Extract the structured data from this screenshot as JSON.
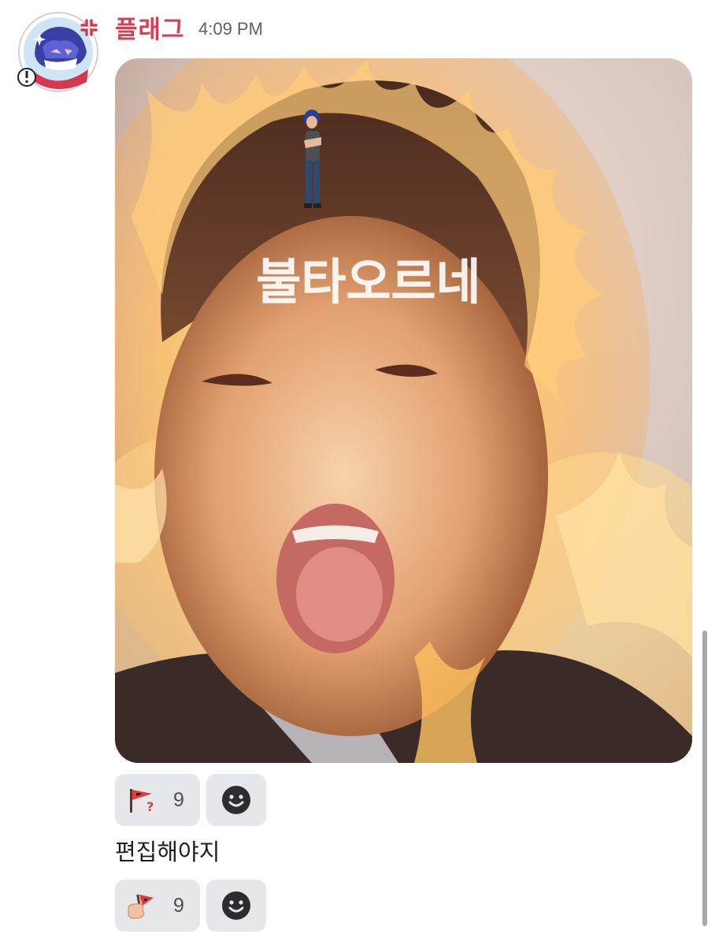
{
  "message": {
    "author": "플래그",
    "time": "4:09 PM",
    "attachment": {
      "overlay_text": "불타오르네"
    },
    "reactions": [
      {
        "emoji": "red-flag-question-icon",
        "count": "9"
      }
    ],
    "text": "편집해야지",
    "text_reactions": [
      {
        "emoji": "hand-holding-flag-icon",
        "count": "9"
      }
    ]
  },
  "colors": {
    "author": "#d73f55",
    "reaction_bg": "#e6e7ea",
    "timestamp": "#5f5f66"
  }
}
